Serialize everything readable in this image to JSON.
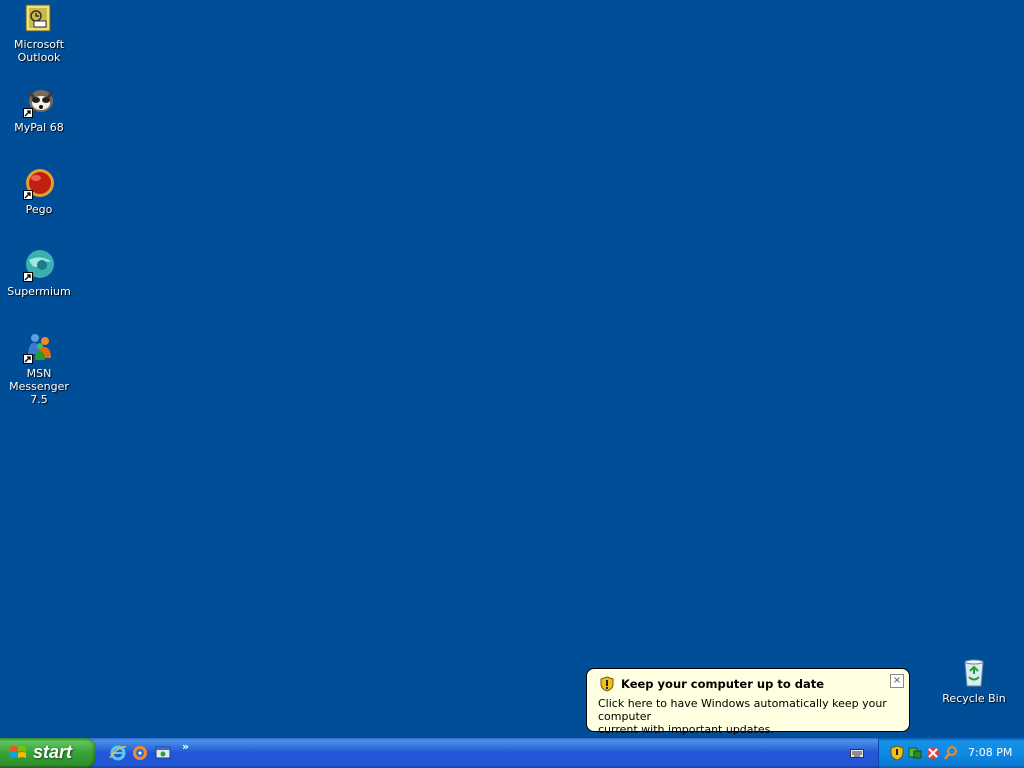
{
  "desktop": {
    "icons": [
      {
        "label": "Microsoft\nOutlook",
        "icon": "outlook-icon"
      },
      {
        "label": "MyPal 68",
        "icon": "mypal-icon"
      },
      {
        "label": "Pego",
        "icon": "pego-icon"
      },
      {
        "label": "Supermium",
        "icon": "supermium-icon"
      },
      {
        "label": "MSN\nMessenger 7.5",
        "icon": "msn-messenger-icon"
      },
      {
        "label": "Recycle Bin",
        "icon": "recycle-bin-icon"
      }
    ]
  },
  "balloon": {
    "title": "Keep your computer up to date",
    "message": "Click here to have Windows automatically keep your computer\ncurrent with important updates.",
    "close": "×"
  },
  "taskbar": {
    "start_label": "start",
    "quick_launch": [
      "internet-explorer-icon",
      "windows-media-icon",
      "show-desktop-icon"
    ],
    "chevron": "»",
    "tray_icons": [
      "security-shield-icon",
      "network-icon",
      "update-icon",
      "search-icon"
    ],
    "clock": "7:08 PM"
  },
  "colors": {
    "desktop": "#004e98",
    "taskbar": "#2157d7",
    "start": "#37a337",
    "balloon": "#ffffe1"
  }
}
